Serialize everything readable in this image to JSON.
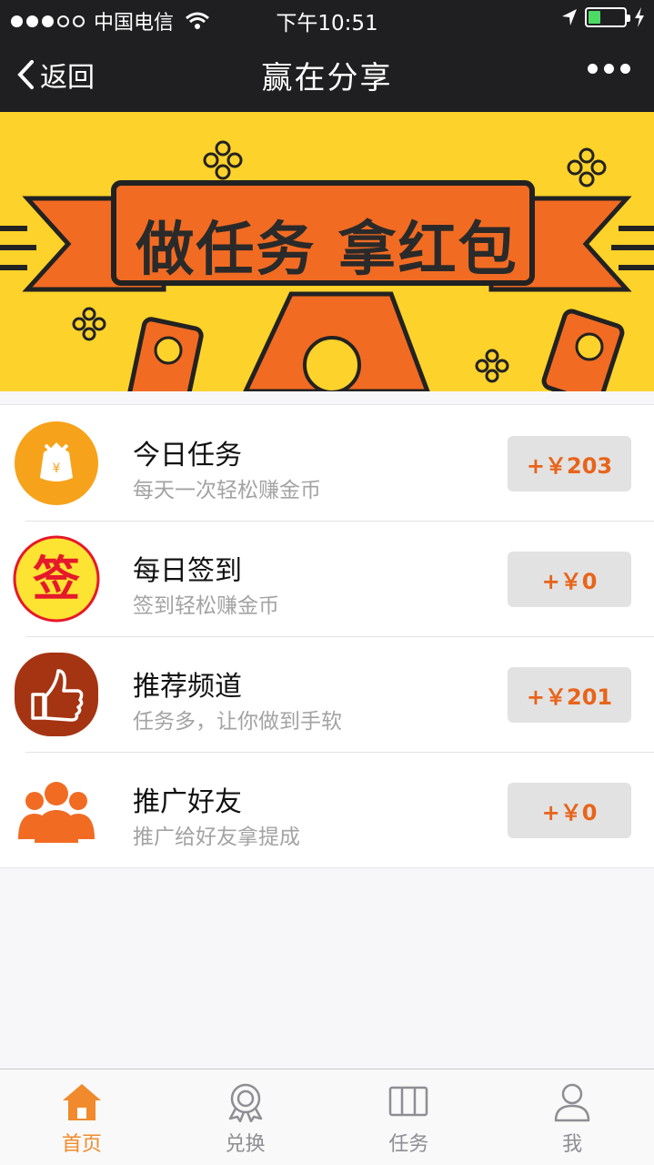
{
  "status_bar": {
    "carrier": "中国电信",
    "time": "下午10:51",
    "battery_level": 0.35
  },
  "nav": {
    "back_label": "返回",
    "title": "赢在分享"
  },
  "banner": {
    "headline": "做任务 拿红包"
  },
  "tasks": [
    {
      "title": "今日任务",
      "subtitle": "每天一次轻松赚金币",
      "reward": "+￥203",
      "icon": "money-bag-icon"
    },
    {
      "title": "每日签到",
      "subtitle": "签到轻松赚金币",
      "reward": "+￥0",
      "icon": "sign-in-icon",
      "icon_char": "签"
    },
    {
      "title": "推荐频道",
      "subtitle": "任务多，让你做到手软",
      "reward": "+￥201",
      "icon": "thumbs-up-icon"
    },
    {
      "title": "推广好友",
      "subtitle": "推广给好友拿提成",
      "reward": "+￥0",
      "icon": "people-icon"
    }
  ],
  "tabbar": {
    "items": [
      {
        "label": "首页",
        "icon": "home-icon",
        "active": true
      },
      {
        "label": "兑换",
        "icon": "badge-icon",
        "active": false
      },
      {
        "label": "任务",
        "icon": "columns-icon",
        "active": false
      },
      {
        "label": "我",
        "icon": "user-icon",
        "active": false
      }
    ]
  },
  "colors": {
    "header_bg": "#1f1f21",
    "banner_bg": "#fdd22a",
    "accent_orange": "#f08a2c",
    "reward_text": "#e8641a",
    "reward_bg": "#e2e2e2"
  }
}
